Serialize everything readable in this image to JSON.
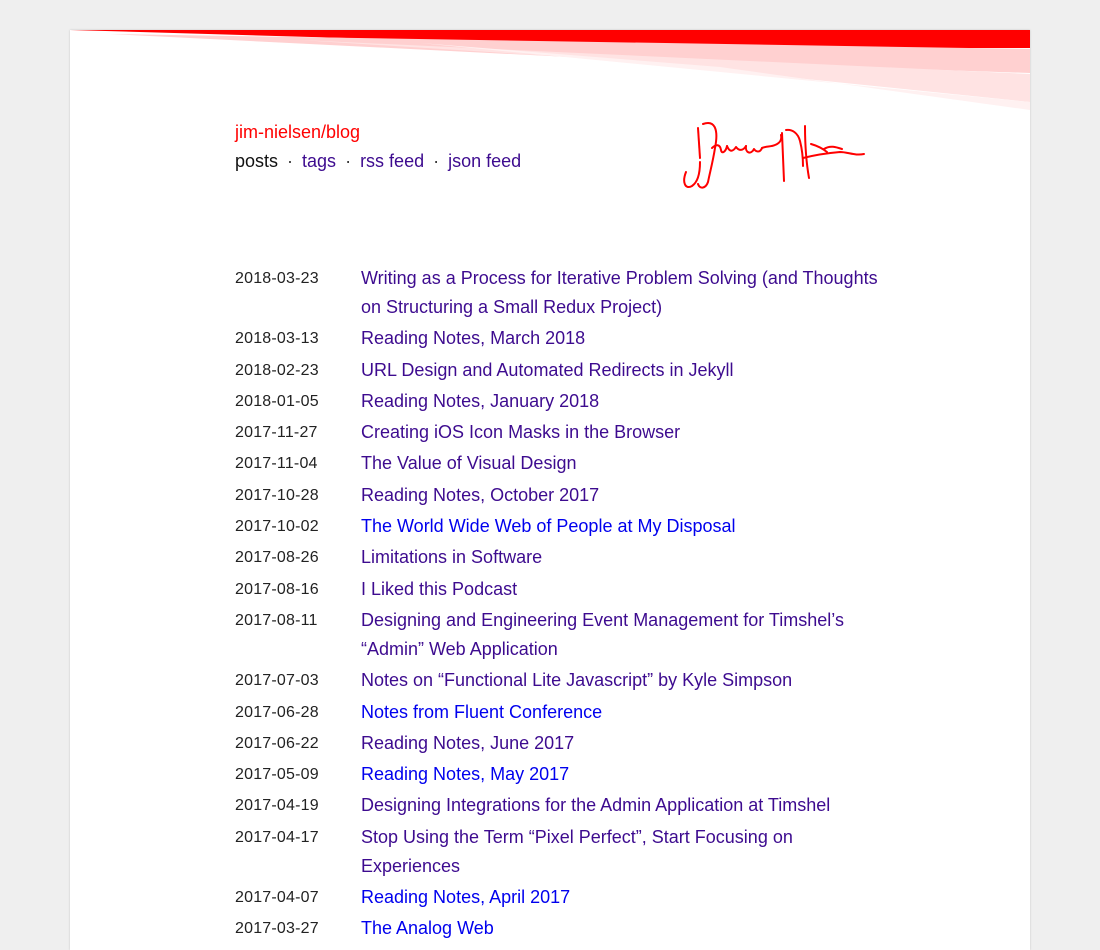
{
  "site": {
    "brand": "jim-nielsen/blog",
    "accent_color": "#ff0000"
  },
  "nav": {
    "items": [
      {
        "label": "posts"
      },
      {
        "label": "tags"
      },
      {
        "label": "rss feed"
      },
      {
        "label": "json feed"
      }
    ],
    "separator": "·"
  },
  "signature": {
    "icon": "handwritten-signature-icon",
    "color": "#ff0000"
  },
  "colors": {
    "visited_link": "#3d0b8f",
    "unvisited_link": "#0000ee"
  },
  "posts": [
    {
      "date": "2018-03-23",
      "title": "Writing as a Process for Iterative Problem Solving (and Thoughts on Structuring a Small Redux Project)",
      "visited": true
    },
    {
      "date": "2018-03-13",
      "title": "Reading Notes, March 2018",
      "visited": true
    },
    {
      "date": "2018-02-23",
      "title": "URL Design and Automated Redirects in Jekyll",
      "visited": true
    },
    {
      "date": "2018-01-05",
      "title": "Reading Notes, January 2018",
      "visited": true
    },
    {
      "date": "2017-11-27",
      "title": "Creating iOS Icon Masks in the Browser",
      "visited": true
    },
    {
      "date": "2017-11-04",
      "title": "The Value of Visual Design",
      "visited": true
    },
    {
      "date": "2017-10-28",
      "title": "Reading Notes, October 2017",
      "visited": true
    },
    {
      "date": "2017-10-02",
      "title": "The World Wide Web of People at My Disposal",
      "visited": false
    },
    {
      "date": "2017-08-26",
      "title": "Limitations in Software",
      "visited": true
    },
    {
      "date": "2017-08-16",
      "title": "I Liked this Podcast",
      "visited": true
    },
    {
      "date": "2017-08-11",
      "title": "Designing and Engineering Event Management for Timshel’s “Admin” Web Application",
      "visited": true
    },
    {
      "date": "2017-07-03",
      "title": "Notes on “Functional Lite Javascript” by Kyle Simpson",
      "visited": true
    },
    {
      "date": "2017-06-28",
      "title": "Notes from Fluent Conference",
      "visited": false
    },
    {
      "date": "2017-06-22",
      "title": "Reading Notes, June 2017",
      "visited": true
    },
    {
      "date": "2017-05-09",
      "title": "Reading Notes, May 2017",
      "visited": false
    },
    {
      "date": "2017-04-19",
      "title": "Designing Integrations for the Admin Application at Timshel",
      "visited": true
    },
    {
      "date": "2017-04-17",
      "title": "Stop Using the Term “Pixel Perfect”, Start Focusing on Experiences",
      "visited": true
    },
    {
      "date": "2017-04-07",
      "title": "Reading Notes, April 2017",
      "visited": false
    },
    {
      "date": "2017-03-27",
      "title": "The Analog Web",
      "visited": false
    }
  ]
}
